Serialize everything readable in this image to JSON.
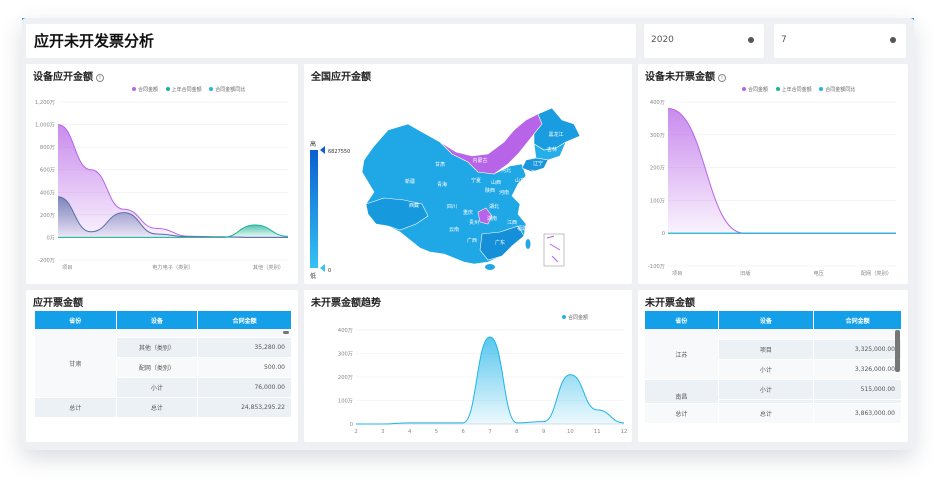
{
  "header": {
    "title": "应开未开发票分析"
  },
  "filters": {
    "year": "2020",
    "month": "7"
  },
  "colors": {
    "purple": "#b764e8",
    "teal": "#1ab394",
    "blue": "#20b4e8",
    "header": "#14a0e8"
  },
  "panels": {
    "device_due": {
      "title": "设备应开金额"
    },
    "china_map": {
      "title": "全国应开金额",
      "legend_high": "高",
      "legend_low": "低",
      "legend_max": "6827550",
      "legend_min": "0"
    },
    "device_unbilled": {
      "title": "设备未开票金额"
    },
    "due_table": {
      "title": "应开票金额"
    },
    "trend": {
      "title": "未开票金额趋势"
    },
    "unbilled_table": {
      "title": "未开票金额"
    }
  },
  "legend_labels": {
    "contract": "合同金额",
    "last_year": "上年合同金额",
    "yoy": "合同金额同比"
  },
  "trend_legend": "合同金额",
  "chart_data": [
    {
      "type": "area",
      "title": "设备应开金额",
      "categories": [
        "项目",
        "电力电子（类别）",
        "其他（类别）"
      ],
      "y_ticks": [
        "1,200万",
        "1,000万",
        "800万",
        "600万",
        "400万",
        "200万",
        "0万",
        "-200万"
      ],
      "ylim": [
        -200,
        1200
      ],
      "series": [
        {
          "name": "合同金额",
          "values": [
            1000,
            600,
            250,
            80,
            10,
            5,
            0,
            0
          ]
        },
        {
          "name": "上年合同金额",
          "values": [
            360,
            50,
            220,
            30,
            5,
            5,
            0,
            0
          ]
        },
        {
          "name": "合同金额同比",
          "values": [
            0,
            0,
            0,
            0,
            0,
            0,
            110,
            10
          ]
        }
      ]
    },
    {
      "type": "area",
      "title": "设备未开票金额",
      "categories": [
        "项目",
        "旧版",
        "电压",
        "配网（类别）"
      ],
      "y_ticks": [
        "400万",
        "300万",
        "200万",
        "100万",
        "0",
        "-100万"
      ],
      "ylim": [
        -100,
        400
      ],
      "series": [
        {
          "name": "合同金额",
          "values": [
            380,
            0,
            0,
            0
          ]
        },
        {
          "name": "上年合同金额",
          "values": [
            0,
            0,
            0,
            0
          ]
        },
        {
          "name": "合同金额同比",
          "values": [
            0,
            0,
            0,
            0
          ]
        }
      ]
    },
    {
      "type": "area",
      "title": "未开票金额趋势",
      "x": [
        2,
        3,
        4,
        5,
        6,
        7,
        8,
        9,
        10,
        11,
        12
      ],
      "y_ticks": [
        "400万",
        "300万",
        "200万",
        "100万",
        "0"
      ],
      "ylim": [
        0,
        400
      ],
      "series": [
        {
          "name": "合同金额",
          "values": [
            0,
            0,
            5,
            5,
            5,
            370,
            5,
            10,
            210,
            60,
            5
          ]
        }
      ]
    }
  ],
  "due_table": {
    "headers": [
      "省份",
      "设备",
      "合同金额"
    ],
    "rows": [
      {
        "province": "",
        "device": "其他（类别）",
        "amount": "35,280.00"
      },
      {
        "province": "甘肃",
        "device": "配网（类别）",
        "amount": "500.00"
      },
      {
        "province": "",
        "device": "小计",
        "amount": "76,000.00"
      },
      {
        "province": "总计",
        "device": "总计",
        "amount": "24,853,295.22"
      }
    ]
  },
  "unbilled_table": {
    "headers": [
      "省份",
      "设备",
      "合同金额"
    ],
    "rows": [
      {
        "province": "",
        "device": "项目",
        "amount": "3,325,000.00"
      },
      {
        "province": "江苏",
        "device": "小计",
        "amount": "3,326,000.00"
      },
      {
        "province": "",
        "device": "小计",
        "amount": "515,000.00"
      },
      {
        "province": "南昌",
        "device": "",
        "amount": ""
      },
      {
        "province": "总计",
        "device": "总计",
        "amount": "3,863,000.00"
      }
    ]
  },
  "map_regions": [
    "新疆",
    "西藏",
    "青海",
    "甘肃",
    "四川",
    "云南",
    "内蒙古",
    "黑龙江",
    "吉林",
    "辽宁",
    "河北",
    "山西",
    "陕西",
    "河南",
    "湖北",
    "湖南",
    "贵州",
    "广西",
    "广东",
    "江西",
    "福建",
    "浙江",
    "安徽",
    "山东",
    "江苏",
    "上海",
    "重庆",
    "宁夏",
    "北京",
    "天津"
  ]
}
